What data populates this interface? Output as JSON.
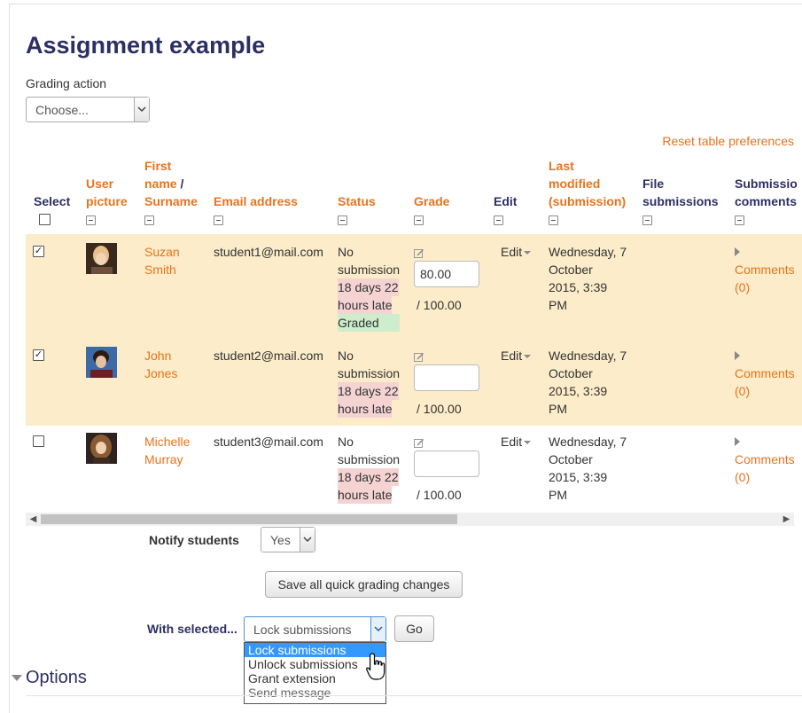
{
  "page": {
    "title": "Assignment example",
    "grading_action_label": "Grading action",
    "grading_action_value": "Choose...",
    "reset_link": "Reset table preferences"
  },
  "table": {
    "headers": {
      "select": "Select",
      "user_picture_1": "User",
      "user_picture_2": "picture",
      "first_name": "First",
      "first_name_2": "name",
      "slash": " /",
      "surname": "Surname",
      "email": "Email address",
      "status": "Status",
      "grade": "Grade",
      "edit": "Edit",
      "last_modified_1": "Last",
      "last_modified_2": "modified",
      "last_modified_3": "(submission)",
      "file_sub_1": "File",
      "file_sub_2": "submissions",
      "sub_comments_1": "Submissio",
      "sub_comments_2": "comments"
    },
    "rows": [
      {
        "selected": true,
        "name_first": "Suzan",
        "name_last": "Smith",
        "email": "student1@mail.com",
        "status_1": "No",
        "status_2": "submission",
        "late_1": "18 days 22",
        "late_2": "hours late",
        "graded": "Graded",
        "grade_value": "80.00",
        "grade_max": "/ 100.00",
        "edit": "Edit",
        "modified_1": "Wednesday, 7",
        "modified_2": "October",
        "modified_3": "2015, 3:39",
        "modified_4": "PM",
        "comments_1": "Comments",
        "comments_2": "(0)"
      },
      {
        "selected": true,
        "name_first": "John",
        "name_last": "Jones",
        "email": "student2@mail.com",
        "status_1": "No",
        "status_2": "submission",
        "late_1": "18 days 22",
        "late_2": "hours late",
        "graded": "",
        "grade_value": "",
        "grade_max": "/ 100.00",
        "edit": "Edit",
        "modified_1": "Wednesday, 7",
        "modified_2": "October",
        "modified_3": "2015, 3:39",
        "modified_4": "PM",
        "comments_1": "Comments",
        "comments_2": "(0)"
      },
      {
        "selected": false,
        "name_first": "Michelle",
        "name_last": "Murray",
        "email": "student3@mail.com",
        "status_1": "No",
        "status_2": "submission",
        "late_1": "18 days 22",
        "late_2": "hours late",
        "graded": "",
        "grade_value": "",
        "grade_max": "/ 100.00",
        "edit": "Edit",
        "modified_1": "Wednesday, 7",
        "modified_2": "October",
        "modified_3": "2015, 3:39",
        "modified_4": "PM",
        "comments_1": "Comments",
        "comments_2": "(0)"
      }
    ]
  },
  "footer": {
    "notify_label": "Notify students",
    "notify_value": "Yes",
    "save_button": "Save all quick grading changes",
    "with_selected_label": "With selected...",
    "with_selected_value": "Lock submissions",
    "go_button": "Go",
    "options": [
      "Lock submissions",
      "Unlock submissions",
      "Grant extension",
      "Send message"
    ],
    "options_heading": "Options"
  },
  "colors": {
    "accent": "#e8731e",
    "heading": "#2c2f63",
    "selected_row": "#fcecc9",
    "late": "#f5d3d3",
    "graded": "#cdedcd",
    "dropdown_highlight": "#3399ff"
  },
  "icons": {
    "collapse": "collapse-icon",
    "pencil": "pencil-icon",
    "expand": "triangle-right-icon",
    "dropdown": "chevron-down-icon"
  }
}
